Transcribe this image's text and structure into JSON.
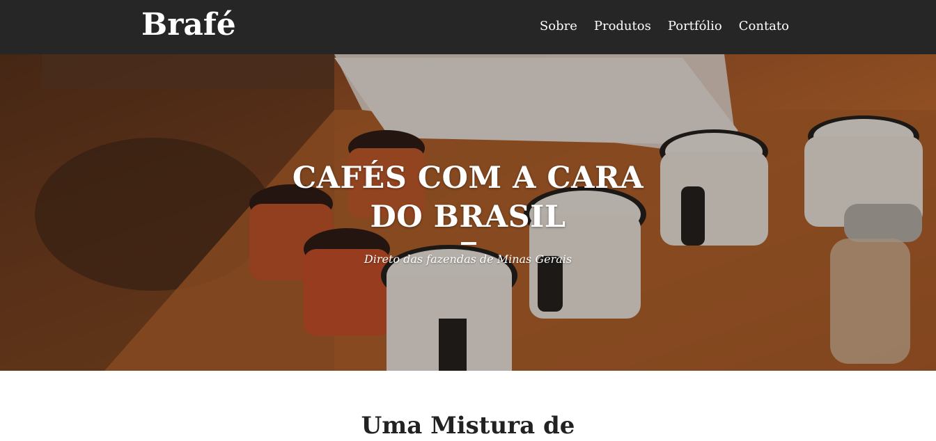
{
  "header": {
    "brand": "Brafé",
    "nav": [
      "Sobre",
      "Produtos",
      "Portfólio",
      "Contato"
    ]
  },
  "hero": {
    "title_line1": "CAFÉS COM A CARA",
    "title_line2": "DO BRASIL",
    "subtitle": "Direto das fazendas de Minas Gerais",
    "image_icon": "coffee-mugs-photo"
  },
  "section": {
    "heading": "Uma Mistura de"
  },
  "colors": {
    "header_bg": "#262626",
    "accent_white": "#ffffff",
    "wood": "#a5582a"
  }
}
